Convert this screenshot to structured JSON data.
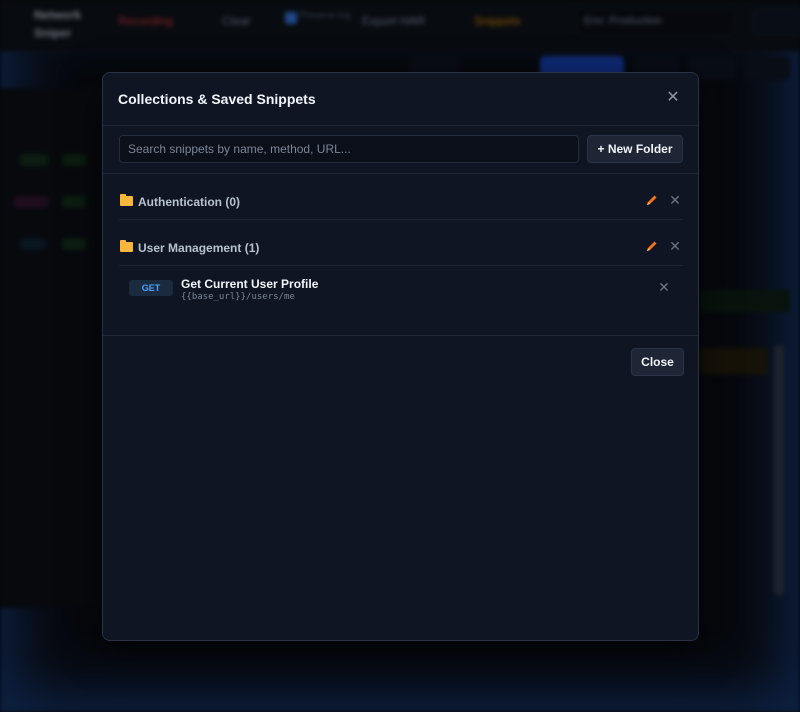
{
  "background_app": {
    "brand": "Network Sniper",
    "record_label": "Recording",
    "clear_label": "Clear",
    "preserve_label": "Preserve log",
    "export_label": "Export HAR",
    "snippets_label": "Snippets",
    "env_select": "Env: Production"
  },
  "modal": {
    "title": "Collections & Saved Snippets",
    "close_icon": "close-icon",
    "search": {
      "placeholder": "Search snippets by name, method, URL...",
      "value": ""
    },
    "new_folder_label": "+ New Folder",
    "folders": [
      {
        "label": "Authentication (0)",
        "icon": "folder-icon"
      },
      {
        "label": "User Management (1)",
        "icon": "folder-icon"
      }
    ],
    "snippets": [
      {
        "method": "GET",
        "name": "Get Current User Profile",
        "url": "{{base_url}}/users/me"
      }
    ],
    "close_label": "Close"
  },
  "colors": {
    "accent_folder": "#f6b73c",
    "edit_icon": "#f97316",
    "method_get": "#4aa3ff",
    "modal_bg": "#0f1523"
  }
}
